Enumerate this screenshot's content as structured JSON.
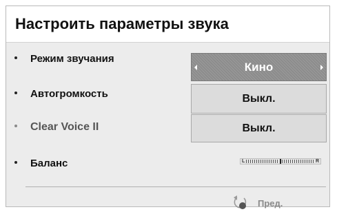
{
  "title": "Настроить параметры звука",
  "rows": [
    {
      "label": "Режим звучания",
      "value": "Кино",
      "selected": true
    },
    {
      "label": "Автогромкость",
      "value": "Выкл.",
      "selected": false
    },
    {
      "label": "Clear Voice II",
      "value": "Выкл.",
      "selected": false,
      "disabled": true
    },
    {
      "label": "Баланс",
      "balance_left": "L",
      "balance_right": "R",
      "balance_level": 0.5
    }
  ],
  "footer": {
    "back_label": "Пред.",
    "back_icon": "return-icon"
  },
  "colors": {
    "panel_bg": "#ececec",
    "selected_bg": "#939393",
    "value_bg": "#dcdcdc"
  }
}
